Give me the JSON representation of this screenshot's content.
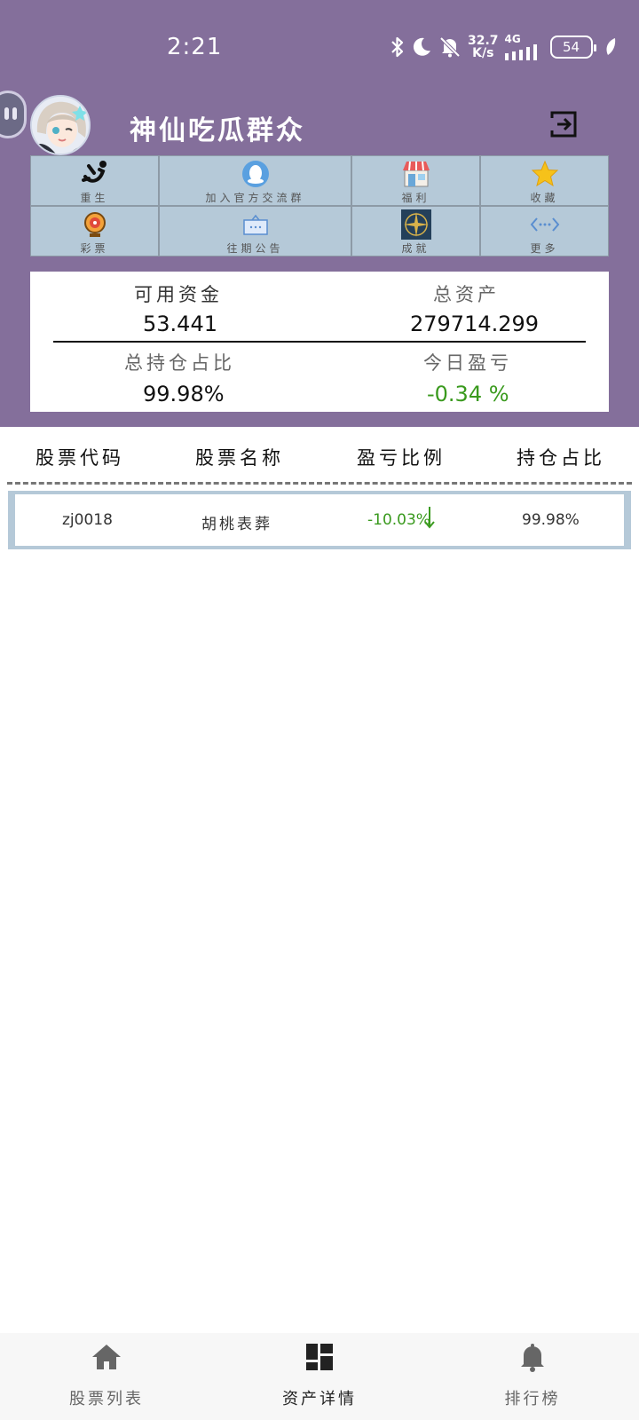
{
  "status_bar": {
    "time": "2:21",
    "net_speed_value": "32.7",
    "net_speed_unit": "K/s",
    "network_type": "4G",
    "battery": "54",
    "icons": [
      "bluetooth-icon",
      "moon-icon",
      "mute-bell-icon",
      "signal-icon",
      "leaf-icon"
    ]
  },
  "profile": {
    "username": "神仙吃瓜群众"
  },
  "shortcuts": [
    {
      "label": "重生",
      "icon": "fall-person-icon"
    },
    {
      "label": "加入官方交流群",
      "icon": "qq-icon"
    },
    {
      "label": "福利",
      "icon": "shop-icon"
    },
    {
      "label": "收藏",
      "icon": "star-icon"
    },
    {
      "label": "彩票",
      "icon": "lottery-wheel-icon"
    },
    {
      "label": "往期公告",
      "icon": "message-box-icon"
    },
    {
      "label": "成就",
      "icon": "compass-icon"
    },
    {
      "label": "更多",
      "icon": "more-code-icon"
    }
  ],
  "assets": {
    "available_funds_label": "可用资金",
    "available_funds": "53.441",
    "total_assets_label": "总资产",
    "total_assets": "279714.299",
    "position_ratio_label": "总持仓占比",
    "position_ratio": "99.98%",
    "today_pl_label": "今日盈亏",
    "today_pl": "-0.34 %"
  },
  "table": {
    "headers": [
      "股票代码",
      "股票名称",
      "盈亏比例",
      "持仓占比"
    ],
    "rows": [
      {
        "code": "zj0018",
        "name": "胡桃表葬",
        "pl": "-10.03%",
        "ratio": "99.98%"
      }
    ]
  },
  "nav": [
    {
      "label": "股票列表",
      "icon": "home-icon"
    },
    {
      "label": "资产详情",
      "icon": "dashboard-icon"
    },
    {
      "label": "排行榜",
      "icon": "bell-icon"
    }
  ],
  "colors": {
    "header_bg": "#846f9b",
    "grid_bg": "#b5c9d8",
    "gain_green": "#3a9a1e",
    "nav_active": "#222222",
    "nav_inactive": "#666666"
  }
}
